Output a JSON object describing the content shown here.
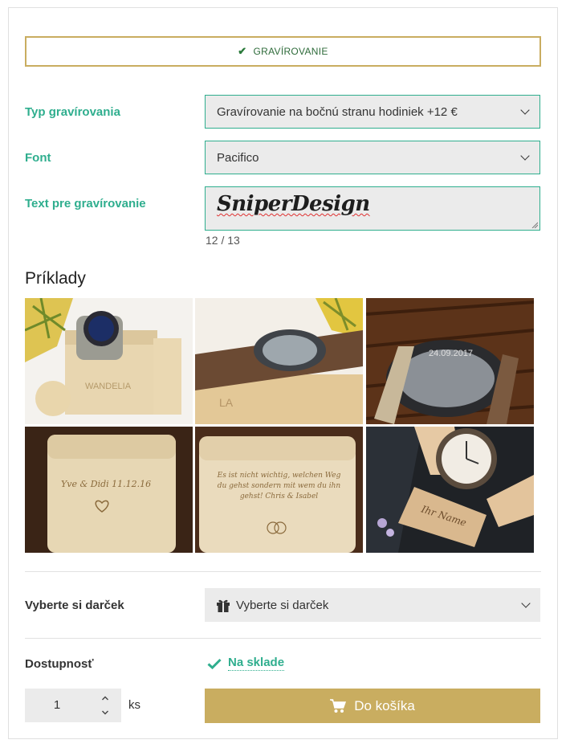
{
  "engraving_toggle": {
    "label": "GRAVÍROVANIE",
    "icon": "check-icon"
  },
  "form": {
    "type_label": "Typ gravírovania",
    "type_value": "Gravírovanie na bočnú stranu hodiniek +12 €",
    "font_label": "Font",
    "font_value": "Pacifico",
    "text_label": "Text pre gravírovanie",
    "text_value": "SniperDesign",
    "counter": "12 / 13"
  },
  "examples": {
    "title": "Príklady",
    "images": [
      {
        "name": "example-wooden-box-watch",
        "engraving": "WANDELIA"
      },
      {
        "name": "example-watch-on-lid",
        "engraving": "LA"
      },
      {
        "name": "example-watch-back-date",
        "engraving": "24.09.2017"
      },
      {
        "name": "example-box-names-date",
        "engraving": "Yve & Didi 11.12.16"
      },
      {
        "name": "example-box-german-quote",
        "engraving": "Es ist nicht wichtig, welchen Weg du gehst sondern mit wem du ihn gehst! Chris & Isabel"
      },
      {
        "name": "example-watch-side-name",
        "engraving": "Ihr Name"
      }
    ]
  },
  "gift": {
    "label": "Vyberte si darček",
    "select_value": "Vyberte si darček",
    "icon": "gift-icon"
  },
  "availability": {
    "label": "Dostupnosť",
    "status": "Na sklade",
    "icon": "check-icon",
    "color": "#2fae8e"
  },
  "quantity": {
    "value": "1",
    "unit": "ks"
  },
  "cart": {
    "label": "Do košíka",
    "icon": "cart-icon",
    "color": "#c9ad60"
  },
  "colors": {
    "accent_green": "#2fae8e",
    "gold": "#c9ad60",
    "field_bg": "#ebebeb"
  }
}
